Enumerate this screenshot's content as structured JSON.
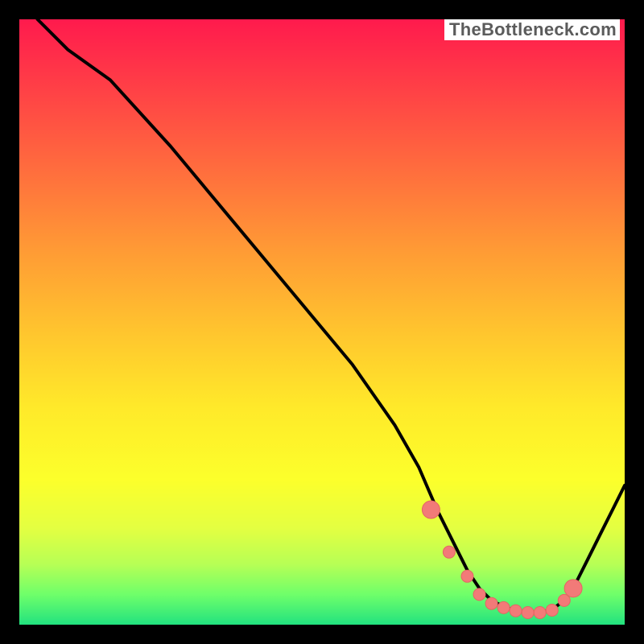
{
  "watermark": "TheBottleneck.com",
  "colors": {
    "curve": "#000000",
    "marker_fill": "#f27a78",
    "marker_stroke": "#e46663"
  },
  "chart_data": {
    "type": "line",
    "title": "",
    "xlabel": "",
    "ylabel": "",
    "xlim": [
      0,
      100
    ],
    "ylim": [
      0,
      100
    ],
    "x": [
      0,
      3,
      8,
      15,
      25,
      35,
      45,
      55,
      62,
      66,
      69,
      72,
      74,
      76,
      78,
      80,
      82,
      84,
      86,
      88,
      90,
      92,
      94,
      96,
      98,
      100
    ],
    "values": [
      105,
      100,
      95,
      90,
      79,
      67,
      55,
      43,
      33,
      26,
      19,
      13,
      9,
      6,
      4,
      3,
      2.3,
      2,
      2,
      2.5,
      4,
      7,
      11,
      15,
      19,
      23
    ],
    "markers": {
      "x": [
        68,
        71,
        74,
        76,
        78,
        80,
        82,
        84,
        86,
        88,
        90,
        91.5
      ],
      "y": [
        19,
        12,
        8,
        5,
        3.5,
        2.8,
        2.3,
        2,
        2,
        2.4,
        4,
        6
      ]
    }
  }
}
